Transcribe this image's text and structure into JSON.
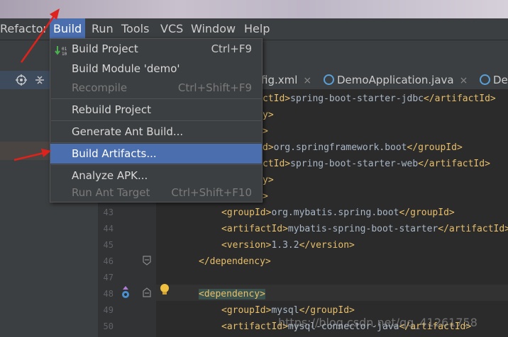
{
  "menubar": {
    "items": [
      {
        "label": "Refactor",
        "active": false
      },
      {
        "label": "Build",
        "active": true
      },
      {
        "label": "Run",
        "active": false
      },
      {
        "label": "Tools",
        "active": false
      },
      {
        "label": "VCS",
        "active": false
      },
      {
        "label": "Window",
        "active": false
      },
      {
        "label": "Help",
        "active": false
      }
    ]
  },
  "left_panel": {
    "icons": [
      "target-icon",
      "collapse-icon"
    ]
  },
  "tabs": [
    {
      "label": "fig.xml",
      "close": "×"
    },
    {
      "label": "DemoApplication.java",
      "close": "×"
    },
    {
      "label": "De"
    }
  ],
  "build_menu": {
    "items": [
      {
        "label": "Build Project",
        "shortcut": "Ctrl+F9",
        "enabled": true
      },
      {
        "label": "Build Module 'demo'",
        "shortcut": "",
        "enabled": true
      },
      {
        "label": "Recompile",
        "shortcut": "Ctrl+Shift+F9",
        "enabled": false
      },
      {
        "label": "Rebuild Project",
        "shortcut": "",
        "enabled": true
      },
      {
        "label": "Generate Ant Build...",
        "shortcut": "",
        "enabled": true
      },
      {
        "label": "Build Artifacts...",
        "shortcut": "",
        "enabled": true,
        "selected": true
      },
      {
        "label": "Analyze APK...",
        "shortcut": "",
        "enabled": true
      },
      {
        "label": "Run Ant Target",
        "shortcut": "Ctrl+Shift+F10",
        "enabled": false
      }
    ]
  },
  "editor": {
    "partial_lines": [
      {
        "tag1": "ctId>",
        "text": "spring-boot-starter-jdbc",
        "tag2": "</artifactId>"
      },
      {
        "tag1": "y>",
        "text": "",
        "tag2": ""
      },
      {
        "tag1": ">",
        "text": "",
        "tag2": ""
      },
      {
        "tag1": "d>",
        "text": "org.springframework.boot",
        "tag2": "</groupId>"
      },
      {
        "tag1": "ctId>",
        "text": "spring-boot-starter-web",
        "tag2": "</artifactId>"
      },
      {
        "tag1": "y>",
        "text": "",
        "tag2": ""
      },
      {
        "tag1": ">",
        "text": "",
        "tag2": ""
      }
    ],
    "lines": [
      {
        "num": "43",
        "tag1": "<groupId>",
        "text": "org.mybatis.spring.boot",
        "tag2": "</groupId>"
      },
      {
        "num": "44",
        "tag1": "<artifactId>",
        "text": "mybatis-spring-boot-starter",
        "tag2": "</artifactId>"
      },
      {
        "num": "45",
        "tag1": "<version>",
        "text": "1.3.2",
        "tag2": "</version>"
      },
      {
        "num": "46",
        "tag1": "</dependency>",
        "text": "",
        "tag2": ""
      },
      {
        "num": "47",
        "tag1": "",
        "text": "",
        "tag2": ""
      },
      {
        "num": "48",
        "tag1": "<dependency>",
        "text": "",
        "tag2": ""
      },
      {
        "num": "49",
        "tag1": "<groupId>",
        "text": "mysql",
        "tag2": "</groupId>"
      },
      {
        "num": "50",
        "tag1": "<artifactId>",
        "text": "mysql-connector-java",
        "tag2": "</artifactId>"
      }
    ]
  },
  "watermark": "https://blog.csdn.net/qq_41261758",
  "colors": {
    "menu_active": "#4b6eaf",
    "tag": "#e8bf6a",
    "text": "#a9b7c6",
    "annotation_arrow": "#e0221c"
  }
}
